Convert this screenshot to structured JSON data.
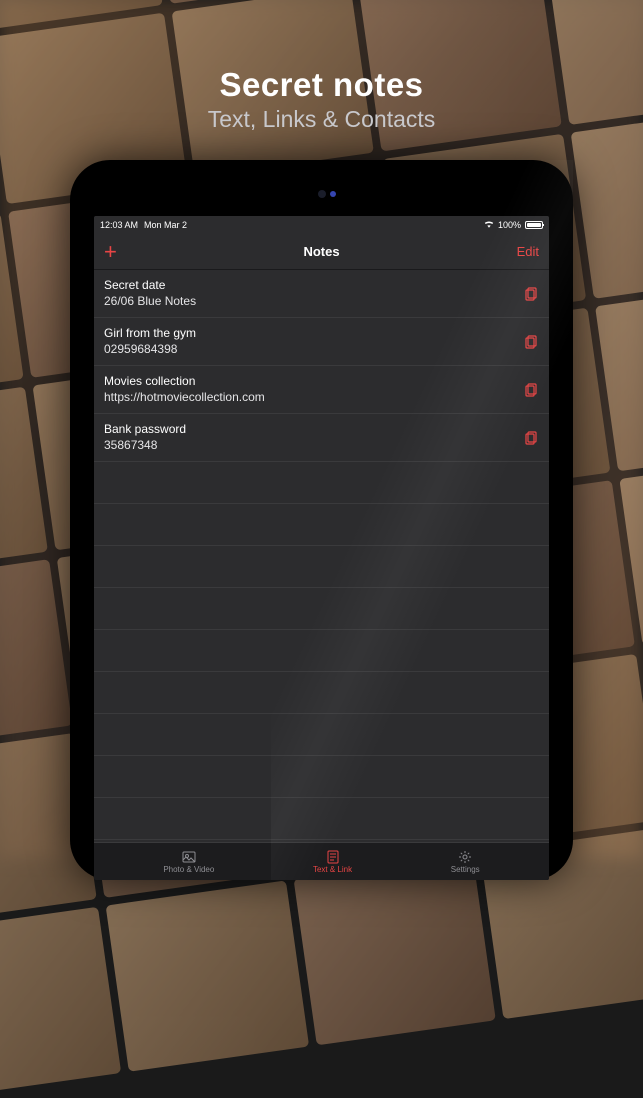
{
  "promo": {
    "title": "Secret notes",
    "subtitle": "Text, Links & Contacts"
  },
  "statusBar": {
    "time": "12:03 AM",
    "date": "Mon Mar 2",
    "battery": "100%"
  },
  "navBar": {
    "title": "Notes",
    "editLabel": "Edit"
  },
  "notes": [
    {
      "title": "Secret date",
      "subtitle": "26/06 Blue Notes"
    },
    {
      "title": "Girl from the gym",
      "subtitle": "02959684398"
    },
    {
      "title": "Movies collection",
      "subtitle": "https://hotmoviecollection.com"
    },
    {
      "title": "Bank password",
      "subtitle": "35867348"
    }
  ],
  "tabs": [
    {
      "label": "Photo & Video",
      "active": false
    },
    {
      "label": "Text & Link",
      "active": true
    },
    {
      "label": "Settings",
      "active": false
    }
  ],
  "colors": {
    "accent": "#e84545",
    "background": "#2c2c2e",
    "text": "#ffffff"
  }
}
